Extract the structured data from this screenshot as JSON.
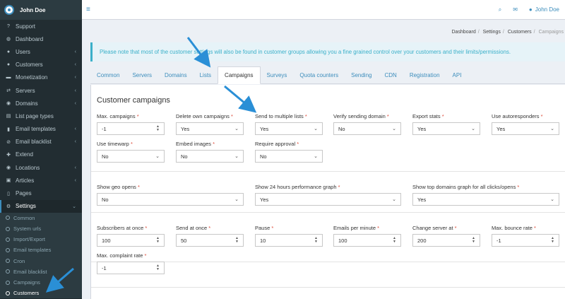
{
  "user": {
    "name": "John Doe"
  },
  "sidebar": {
    "items": [
      {
        "label": "Support",
        "icon": "question-icon",
        "glyph": "?",
        "chev": ""
      },
      {
        "label": "Dashboard",
        "icon": "dashboard-icon",
        "glyph": "◍",
        "chev": ""
      },
      {
        "label": "Users",
        "icon": "user-icon",
        "glyph": "●",
        "chev": "‹"
      },
      {
        "label": "Customers",
        "icon": "users-icon",
        "glyph": "●",
        "chev": "‹"
      },
      {
        "label": "Monetization",
        "icon": "money-icon",
        "glyph": "▬",
        "chev": "‹"
      },
      {
        "label": "Servers",
        "icon": "servers-icon",
        "glyph": "⇄",
        "chev": "‹"
      },
      {
        "label": "Domains",
        "icon": "globe-icon",
        "glyph": "◉",
        "chev": "‹"
      },
      {
        "label": "List page types",
        "icon": "list-icon",
        "glyph": "▤",
        "chev": ""
      },
      {
        "label": "Email templates",
        "icon": "template-icon",
        "glyph": "▮",
        "chev": "‹"
      },
      {
        "label": "Email blacklist",
        "icon": "ban-icon",
        "glyph": "⊘",
        "chev": "‹"
      },
      {
        "label": "Extend",
        "icon": "plug-icon",
        "glyph": "✚",
        "chev": ""
      },
      {
        "label": "Locations",
        "icon": "location-icon",
        "glyph": "◉",
        "chev": "‹"
      },
      {
        "label": "Articles",
        "icon": "book-icon",
        "glyph": "▣",
        "chev": "‹"
      },
      {
        "label": "Pages",
        "icon": "page-icon",
        "glyph": "▯",
        "chev": ""
      },
      {
        "label": "Settings",
        "icon": "gear-icon",
        "glyph": "⚙",
        "chev": "⌄"
      }
    ],
    "sub_items": [
      {
        "label": "Common"
      },
      {
        "label": "System urls"
      },
      {
        "label": "Import/Export"
      },
      {
        "label": "Email templates"
      },
      {
        "label": "Cron"
      },
      {
        "label": "Email blacklist"
      },
      {
        "label": "Campaigns"
      },
      {
        "label": "Customers"
      }
    ]
  },
  "breadcrumb": {
    "items": [
      "Dashboard",
      "Settings",
      "Customers"
    ],
    "current": "Campaigns"
  },
  "notice": "Please note that most of the customer settings will also be found in customer groups allowing you a fine grained control over your customers and their limits/permissions.",
  "tabs": [
    "Common",
    "Servers",
    "Domains",
    "Lists",
    "Campaigns",
    "Surveys",
    "Quota counters",
    "Sending",
    "CDN",
    "Registration",
    "API"
  ],
  "panel": {
    "title": "Customer campaigns",
    "fields": {
      "max_campaigns": {
        "label": "Max. campaigns",
        "value": "-1"
      },
      "delete_own": {
        "label": "Delete own campaigns",
        "value": "Yes"
      },
      "send_multiple": {
        "label": "Send to multiple lists",
        "value": "Yes"
      },
      "verify_domain": {
        "label": "Verify sending domain",
        "value": "No"
      },
      "export_stats": {
        "label": "Export stats",
        "value": "Yes"
      },
      "autoresponders": {
        "label": "Use autoresponders",
        "value": "Yes"
      },
      "timewarp": {
        "label": "Use timewarp",
        "value": "No"
      },
      "embed_images": {
        "label": "Embed images",
        "value": "No"
      },
      "require_approval": {
        "label": "Require approval",
        "value": "No"
      },
      "geo_opens": {
        "label": "Show geo opens",
        "value": "No"
      },
      "perf_graph": {
        "label": "Show 24 hours performance graph",
        "value": "Yes"
      },
      "top_domains": {
        "label": "Show top domains graph for all clicks/opens",
        "value": "Yes"
      },
      "subs_at_once": {
        "label": "Subscribers at once",
        "value": "100"
      },
      "send_at_once": {
        "label": "Send at once",
        "value": "50"
      },
      "pause": {
        "label": "Pause",
        "value": "10"
      },
      "emails_per_min": {
        "label": "Emails per minute",
        "value": "100"
      },
      "change_server": {
        "label": "Change server at",
        "value": "200"
      },
      "bounce_rate": {
        "label": "Max. bounce rate",
        "value": "-1"
      },
      "complaint_rate": {
        "label": "Max. complaint rate",
        "value": "-1"
      }
    },
    "required_mark": "*"
  },
  "colors": {
    "sidebar_bg": "#222d32",
    "accent": "#3c8dbc",
    "notice": "#3ab0c9",
    "required": "#dd4b39",
    "arrow": "#2a8fd6"
  }
}
